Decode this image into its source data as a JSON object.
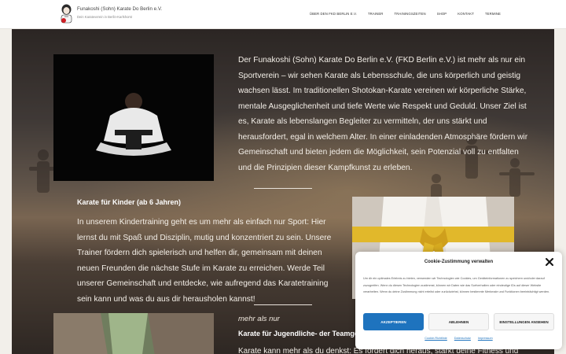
{
  "header": {
    "site_title": "Funakoshi (Sohn) Karate Do Berlin e.V.",
    "tagline": "Dein Karateverein in Berlin-Karlshorst",
    "nav": [
      {
        "label": "Über den FKD Berlin e.V."
      },
      {
        "label": "Trainer"
      },
      {
        "label": "Trainingszeiten"
      },
      {
        "label": "Shop"
      },
      {
        "label": "Kontakt"
      },
      {
        "label": "Termine"
      }
    ]
  },
  "main": {
    "intro": "Der Funakoshi (Sohn) Karate Do Berlin e.V. (FKD Berlin e.V.) ist mehr als nur ein Sportverein – wir sehen Karate als Lebensschule, die uns körperlich und geistig wachsen lässt. Im traditionellen Shotokan-Karate vereinen wir körperliche Stärke, mentale Ausgeglichenheit und tiefe Werte wie Respekt und Geduld. Unser Ziel ist es, Karate als lebenslangen Begleiter zu vermitteln, der uns stärkt und herausfordert, egal in welchem Alter. In einer einladenden Atmosphäre fördern wir Gemeinschaft und bieten jedem die Möglichkeit, sein Potenzial voll zu entfalten und die Prinzipien dieser Kampfkunst zu erleben.",
    "kids_heading": "Karate für Kinder (ab 6 Jahren)",
    "kids_text": "In unserem Kindertraining geht es um mehr als einfach nur Sport: Hier lernst du mit Spaß und Disziplin, mutig und konzentriert zu sein. Unsere Trainer fördern dich spielerisch und helfen dir, gemeinsam mit deinen neuen Freunden die nächste Stufe im Karate zu erreichen. Werde Teil unserer Gemeinschaft und entdecke, wie aufregend das Karatetraining sein kann und was du aus dir herausholen kannst!",
    "more_label": "mehr als nur",
    "teen_heading": "Karate für Jugendliche- der Teamgeist zählt",
    "teen_text": "Karate kann mehr als du denkst: Es fordert dich heraus, stärkt deine Fitness und"
  },
  "cookie": {
    "title": "Cookie-Zustimmung verwalten",
    "text": "Um dir ein optimales Erlebnis zu bieten, verwenden wir Technologien wie Cookies, um Geräteinformationen zu speichern und/oder darauf zuzugreifen. Wenn du diesen Technologien zustimmst, können wir Daten wie das Surfverhalten oder eindeutige IDs auf dieser Website verarbeiten. Wenn du deine Zustimmung nicht erteilst oder zurückziehst, können bestimmte Merkmale und Funktionen beeinträchtigt werden.",
    "accept": "Akzeptieren",
    "deny": "Ablehnen",
    "preferences": "Einstellungen ansehen",
    "links": [
      "Cookie-Richtlinie",
      "Datenschutz",
      "Impressum"
    ]
  },
  "colors": {
    "accent": "#1e73be",
    "belt_yellow": "#e1b82b"
  }
}
